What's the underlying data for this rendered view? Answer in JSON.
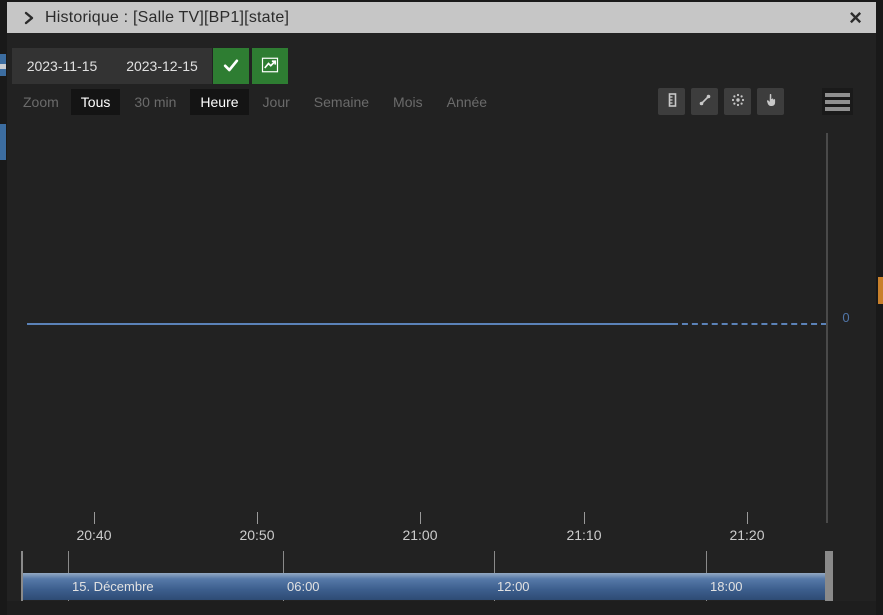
{
  "window": {
    "title": "Historique : [Salle TV][BP1][state]",
    "close_glyph": "×"
  },
  "controls": {
    "date_from": "2023-11-15",
    "date_to": "2023-12-15"
  },
  "zoom_bar": {
    "label": "Zoom",
    "buttons": [
      {
        "label": "Tous",
        "active": true
      },
      {
        "label": "30 min",
        "active": false
      },
      {
        "label": "Heure",
        "active": true
      },
      {
        "label": "Jour",
        "active": false
      },
      {
        "label": "Semaine",
        "active": false
      },
      {
        "label": "Mois",
        "active": false
      },
      {
        "label": "Année",
        "active": false
      }
    ]
  },
  "toolbar": {
    "icons": [
      "ruler-icon",
      "line-style-icon",
      "scatter-points-icon",
      "pan-hand-icon"
    ],
    "menu": "hamburger-menu-icon"
  },
  "chart_data": {
    "type": "line",
    "title": "",
    "x_tick_labels": [
      "20:40",
      "20:50",
      "21:00",
      "21:10",
      "21:20"
    ],
    "y_tick_labels": [
      "0"
    ],
    "ylim": null,
    "grid": false,
    "series": [
      {
        "name": "[Salle TV][BP1][state]",
        "value": 0,
        "style": "solid then dashed extrapolation"
      }
    ],
    "colors": {
      "line": "#5b82b8",
      "axis": "#4a4a4a",
      "x_labels": "#cccccc",
      "y_label": "#5075a8"
    }
  },
  "navigator": {
    "labels": [
      "15. Décembre",
      "06:00",
      "12:00",
      "18:00"
    ]
  },
  "colors": {
    "titlebar_bg": "#c6c6c6",
    "dialog_bg": "#222222",
    "accent_green": "#2e7d32",
    "navigator_blue": "#3d5f8e",
    "strip_blue": "#3c6da0",
    "strip_orange": "#c9802b"
  }
}
